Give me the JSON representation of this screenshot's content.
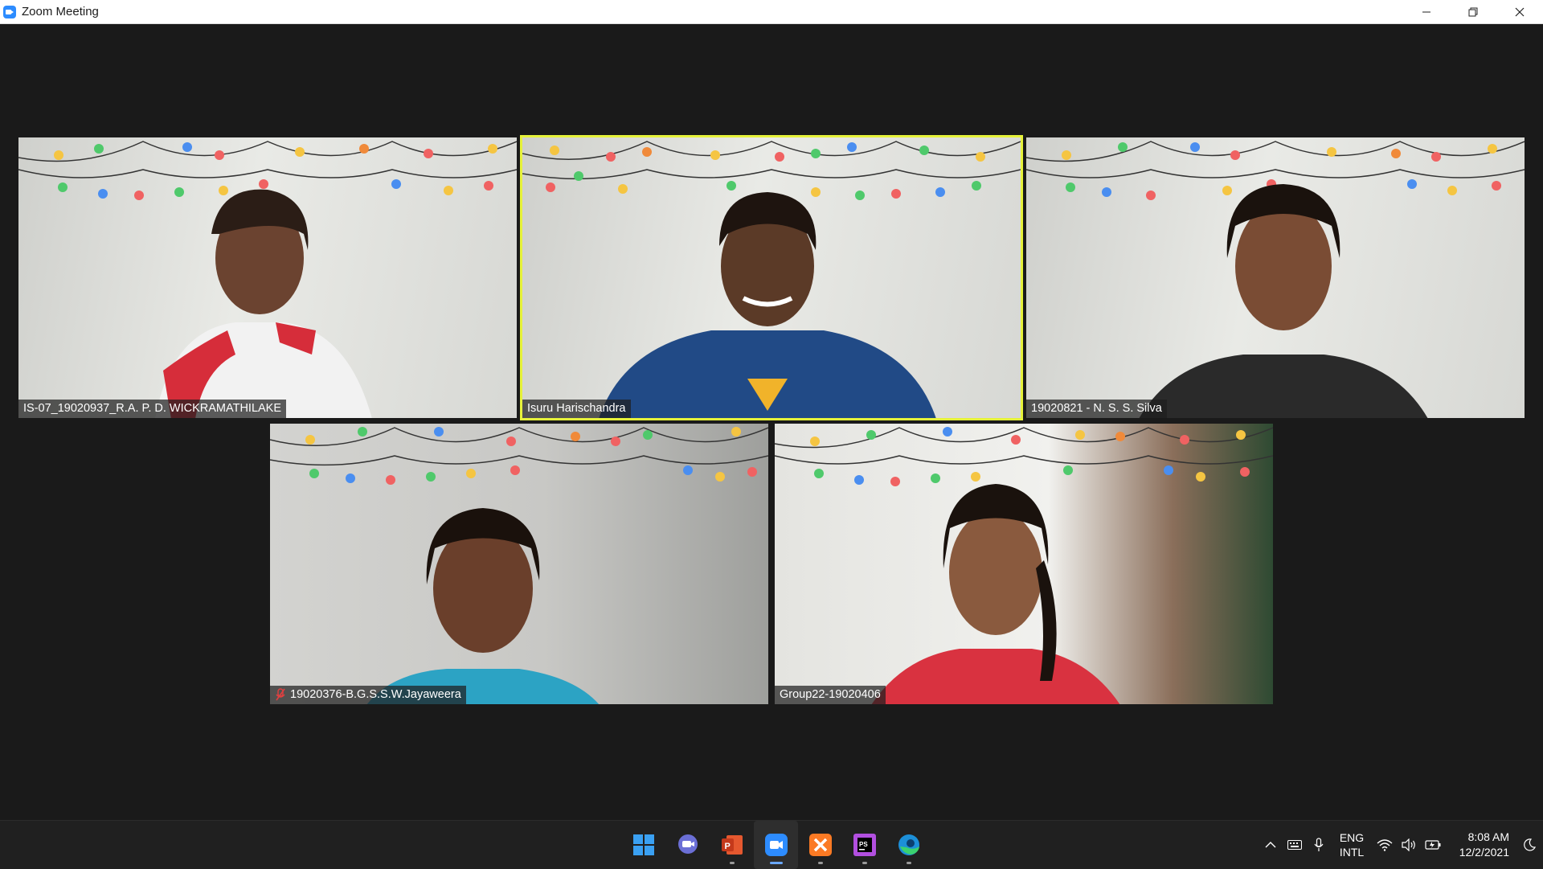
{
  "window": {
    "title": "Zoom Meeting",
    "controls": [
      "minimize",
      "restore",
      "close"
    ]
  },
  "participants": [
    {
      "name": "IS-07_19020937_R.A. P. D. WICKRAMATHILAKE",
      "active_speaker": false,
      "muted": false
    },
    {
      "name": "Isuru Harischandra",
      "active_speaker": true,
      "muted": false
    },
    {
      "name": "19020821 - N. S. S. Silva",
      "active_speaker": false,
      "muted": false
    },
    {
      "name": "19020376-B.G.S.S.W.Jayaweera",
      "active_speaker": false,
      "muted": true
    },
    {
      "name": "Group22-19020406",
      "active_speaker": false,
      "muted": false
    }
  ],
  "colors": {
    "active_speaker_border": "#e6f23a",
    "stage_bg": "#1a1a1a",
    "taskbar_bg": "#202020"
  },
  "taskbar": {
    "apps": [
      {
        "icon": "windows-start-icon",
        "active": false,
        "running": false
      },
      {
        "icon": "teams-chat-icon",
        "active": false,
        "running": false
      },
      {
        "icon": "powerpoint-icon",
        "active": false,
        "running": true
      },
      {
        "icon": "zoom-icon",
        "active": true,
        "running": true
      },
      {
        "icon": "xampp-icon",
        "active": false,
        "running": true
      },
      {
        "icon": "phpstorm-icon",
        "active": false,
        "running": true
      },
      {
        "icon": "edge-icon",
        "active": false,
        "running": true
      }
    ],
    "tray": {
      "language_line1": "ENG",
      "language_line2": "INTL",
      "time": "8:08 AM",
      "date": "12/2/2021"
    }
  }
}
